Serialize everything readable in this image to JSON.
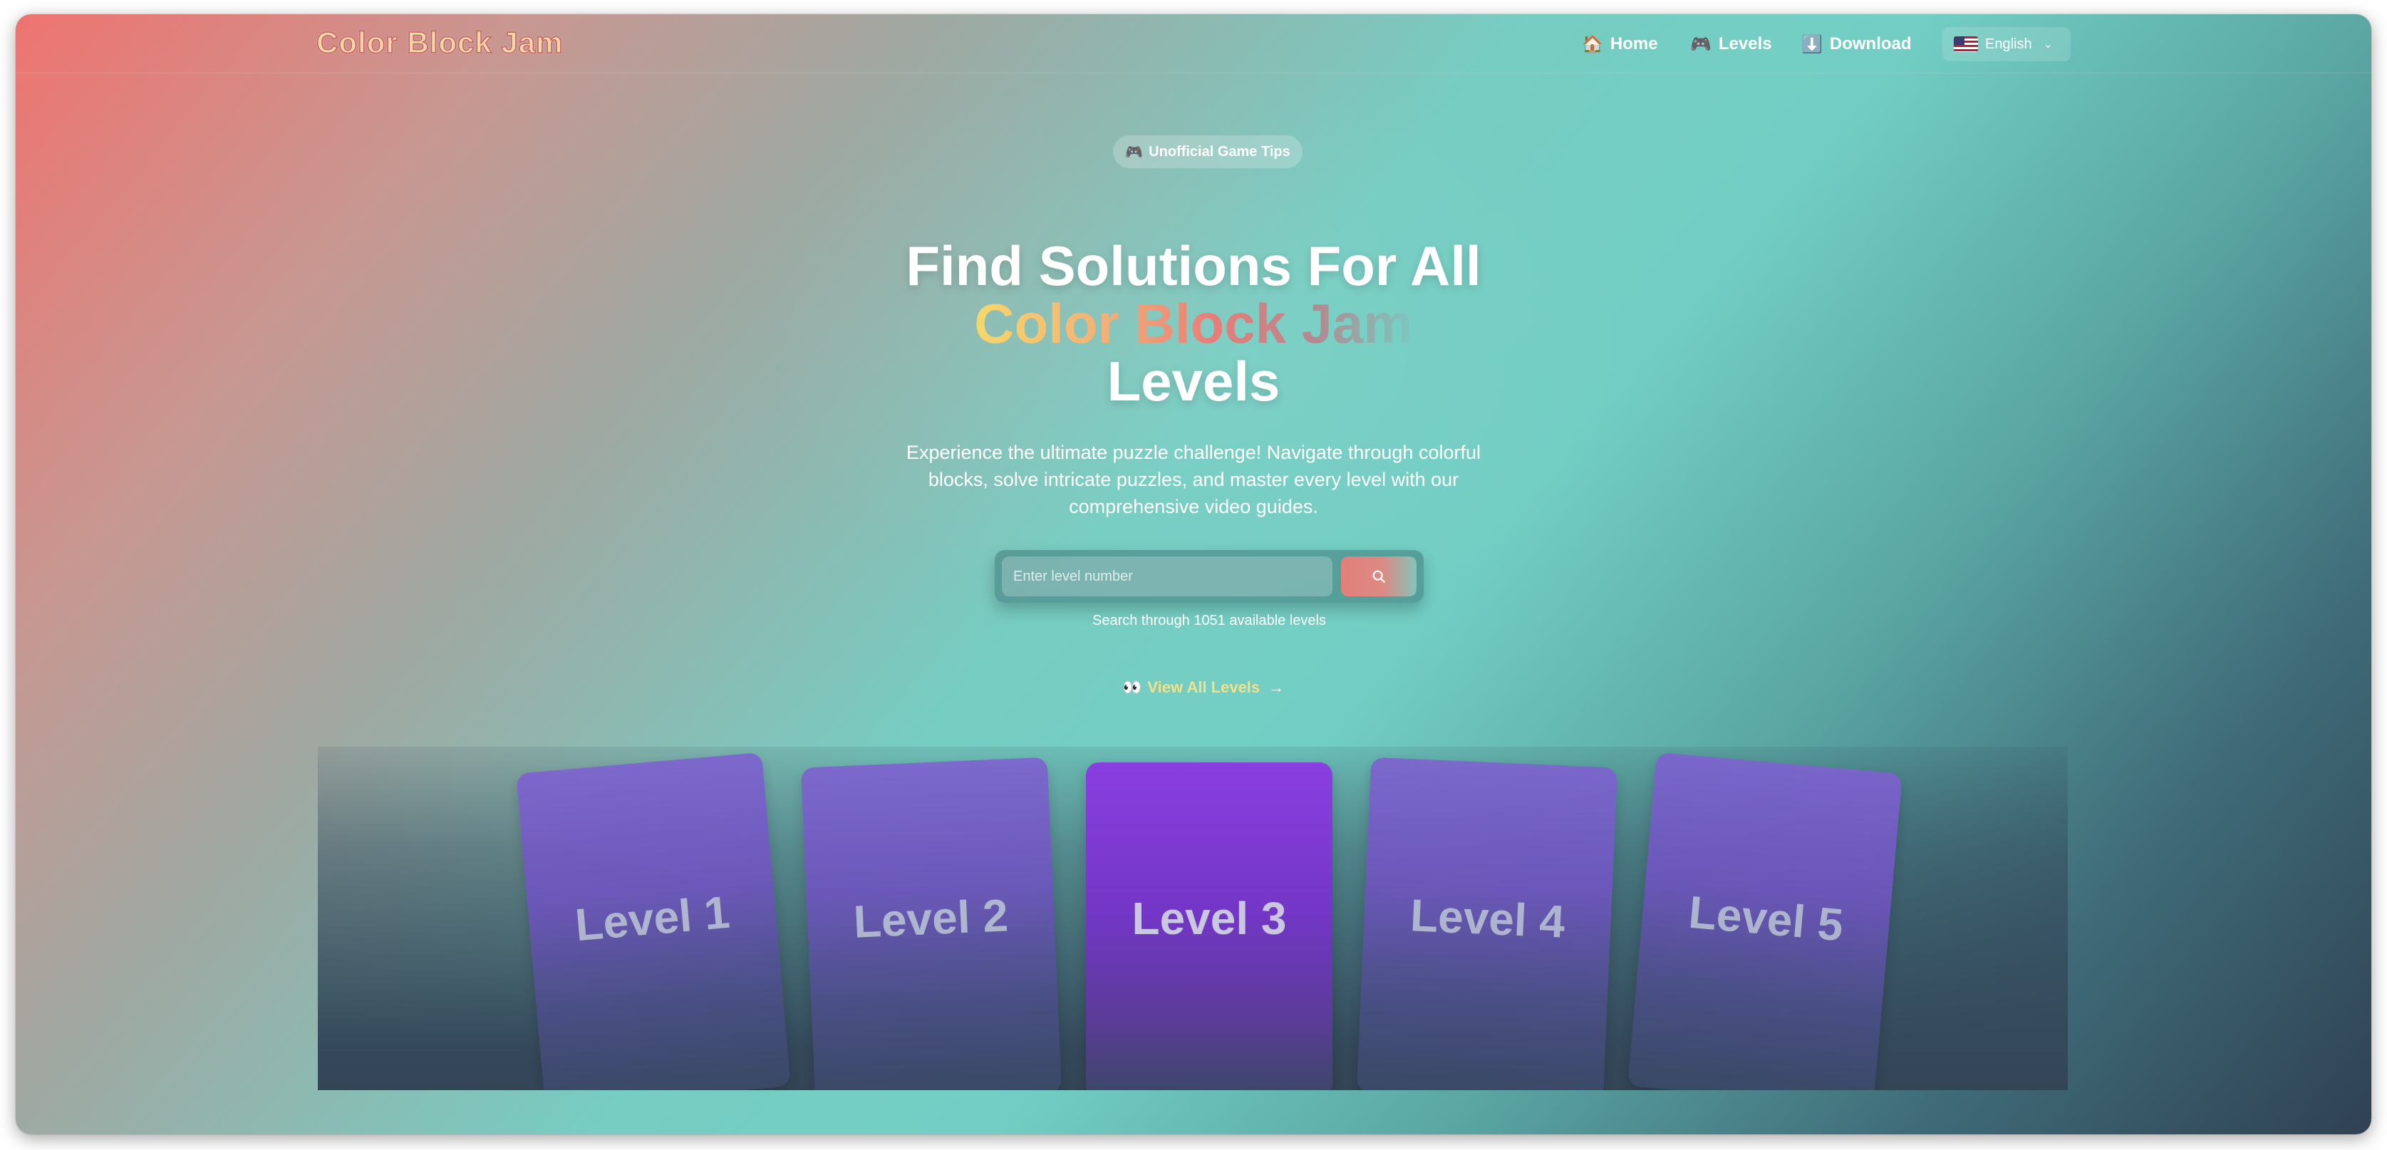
{
  "brand": {
    "logo": "Color Block Jam"
  },
  "nav": {
    "home": {
      "icon": "🏠",
      "label": "Home"
    },
    "levels": {
      "icon": "🎮",
      "label": "Levels"
    },
    "download": {
      "icon": "⬇️",
      "label": "Download"
    },
    "language": {
      "label": "English",
      "flag": "us-flag-icon"
    }
  },
  "hero": {
    "badge": {
      "icon": "🎮",
      "label": "Unofficial Game Tips"
    },
    "title_line1": "Find Solutions For All",
    "title_line2": "Color Block Jam",
    "title_line3": "Levels",
    "subtitle": "Experience the ultimate puzzle challenge! Navigate through colorful blocks, solve intricate puzzles, and master every level with our comprehensive video guides.",
    "search": {
      "placeholder": "Enter level number",
      "value": "",
      "hint": "Search through 1051 available levels"
    },
    "view_all": {
      "icon": "👀",
      "label": "View All Levels",
      "arrow": "→"
    }
  },
  "cards": [
    {
      "label": "Level 1"
    },
    {
      "label": "Level 2"
    },
    {
      "label": "Level 3"
    },
    {
      "label": "Level 4"
    },
    {
      "label": "Level 5"
    }
  ],
  "colors": {
    "accent_yellow": "#f5e08a",
    "gradient_pink": "#ee7470",
    "gradient_teal": "#72cec4",
    "card_purple": "#7e62d0",
    "card_active": "#8a3fe0"
  }
}
